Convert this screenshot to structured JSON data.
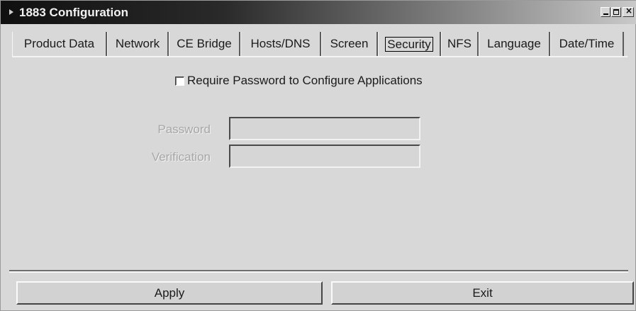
{
  "window": {
    "title": "1883 Configuration"
  },
  "tabs": [
    {
      "label": "Product Data"
    },
    {
      "label": "Network"
    },
    {
      "label": "CE Bridge"
    },
    {
      "label": "Hosts/DNS"
    },
    {
      "label": "Screen"
    },
    {
      "label": "Security",
      "active": true
    },
    {
      "label": "NFS"
    },
    {
      "label": "Language"
    },
    {
      "label": "Date/Time"
    }
  ],
  "security": {
    "require_password_label": "Require Password to Configure Applications",
    "require_password_checked": false,
    "password_label": "Password",
    "password_value": "",
    "verification_label": "Verification",
    "verification_value": ""
  },
  "buttons": {
    "apply": "Apply",
    "exit": "Exit"
  }
}
